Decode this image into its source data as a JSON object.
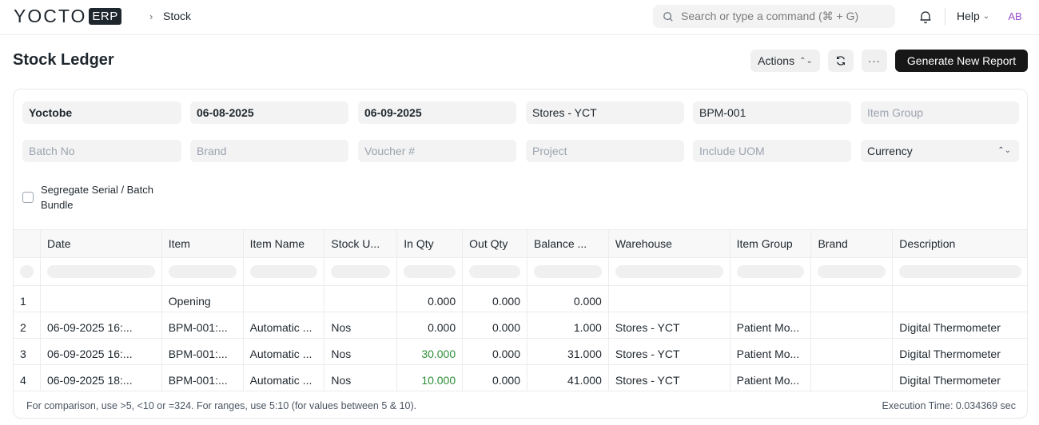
{
  "navbar": {
    "logo_text": "YOCTO",
    "logo_badge": "ERP",
    "breadcrumb_sep": "›",
    "breadcrumb": "Stock",
    "search_placeholder": "Search or type a command (⌘ + G)",
    "help_label": "Help",
    "avatar_initials": "AB"
  },
  "page": {
    "title": "Stock Ledger",
    "actions_label": "Actions",
    "more_label": "···",
    "primary_label": "Generate New Report"
  },
  "filters": {
    "company": "Yoctobe",
    "from_date": "06-08-2025",
    "to_date": "06-09-2025",
    "warehouse": "Stores - YCT",
    "item": "BPM-001",
    "item_group_ph": "Item Group",
    "batch_no_ph": "Batch No",
    "brand_ph": "Brand",
    "voucher_ph": "Voucher #",
    "project_ph": "Project",
    "include_uom_ph": "Include UOM",
    "currency": "Currency",
    "segregate_label": "Segregate Serial / Batch Bundle"
  },
  "table": {
    "columns": [
      "Date",
      "Item",
      "Item Name",
      "Stock U...",
      "In Qty",
      "Out Qty",
      "Balance ...",
      "Warehouse",
      "Item Group",
      "Brand",
      "Description"
    ],
    "rows": [
      {
        "idx": "1",
        "date": "",
        "item": "Opening",
        "item_name": "",
        "uom": "",
        "in_qty": "0.000",
        "out_qty": "0.000",
        "balance": "0.000",
        "warehouse": "",
        "item_group": "",
        "brand": "",
        "description": ""
      },
      {
        "idx": "2",
        "date": "06-09-2025 16:...",
        "item": "BPM-001:...",
        "item_name": "Automatic ...",
        "uom": "Nos",
        "in_qty": "0.000",
        "out_qty": "0.000",
        "balance": "1.000",
        "warehouse": "Stores - YCT",
        "item_group": "Patient Mo...",
        "brand": "",
        "description": "Digital Thermometer"
      },
      {
        "idx": "3",
        "date": "06-09-2025 16:...",
        "item": "BPM-001:...",
        "item_name": "Automatic ...",
        "uom": "Nos",
        "in_qty": "30.000",
        "out_qty": "0.000",
        "balance": "31.000",
        "warehouse": "Stores - YCT",
        "item_group": "Patient Mo...",
        "brand": "",
        "description": "Digital Thermometer"
      },
      {
        "idx": "4",
        "date": "06-09-2025 18:...",
        "item": "BPM-001:...",
        "item_name": "Automatic ...",
        "uom": "Nos",
        "in_qty": "10.000",
        "out_qty": "0.000",
        "balance": "41.000",
        "warehouse": "Stores - YCT",
        "item_group": "Patient Mo...",
        "brand": "",
        "description": "Digital Thermometer"
      }
    ]
  },
  "footer": {
    "hint": "For comparison, use >5, <10 or =324. For ranges, use 5:10 (for values between 5 & 10).",
    "exec_time": "Execution Time: 0.034369 sec"
  },
  "colors": {
    "positive_qty": "#2f8f3a",
    "primary_button": "#171717",
    "avatar": "#9b4dca"
  }
}
